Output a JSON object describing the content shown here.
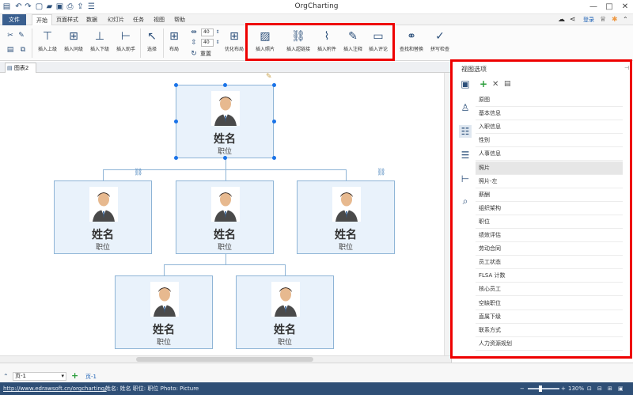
{
  "app": {
    "title": "OrgCharting",
    "login": "登录"
  },
  "menu": {
    "file": "文件",
    "items": [
      "开始",
      "页面样式",
      "数据",
      "幻灯片",
      "任务",
      "视图",
      "帮助"
    ]
  },
  "ribbon": {
    "insert_superior": "插入上级",
    "insert_peer": "插入同级",
    "insert_subordinate": "插入下级",
    "insert_assistant": "插入助手",
    "select": "选择",
    "layout": "布局",
    "spacing_h": "40",
    "spacing_v": "40",
    "reset": "重置",
    "optimize_layout": "优化布局",
    "insert_photo": "插入照片",
    "insert_hyperlink": "插入超链接",
    "insert_attachment": "插入附件",
    "insert_note": "插入注释",
    "insert_comment": "插入评论",
    "find_replace": "查找和替换",
    "spell_check": "拼写检查"
  },
  "tabs": {
    "doc_tab": "图表2"
  },
  "org": {
    "nodes": [
      {
        "name": "姓名",
        "job": "职位"
      },
      {
        "name": "姓名",
        "job": "职位"
      },
      {
        "name": "姓名",
        "job": "职位"
      },
      {
        "name": "姓名",
        "job": "职位"
      },
      {
        "name": "姓名",
        "job": "职位"
      },
      {
        "name": "姓名",
        "job": "职位"
      }
    ]
  },
  "view_panel": {
    "title": "视图选项",
    "items": [
      "原图",
      "基本信息",
      "入职信息",
      "性别",
      "人事信息",
      "照片",
      "照片-左",
      "薪酬",
      "组织架构",
      "职位",
      "绩效评估",
      "劳动合同",
      "员工状态",
      "FLSA 计数",
      "核心员工",
      "空缺职位",
      "直属下级",
      "联系方式",
      "人力资源规划"
    ],
    "selected": "照片"
  },
  "pagebar": {
    "page_select": "页-1",
    "page_tab": "页-1"
  },
  "status": {
    "url": "http://www.edrawsoft.cn/orgcharting/",
    "info": "姓名: 姓名  职位: 职位  Photo: Picture",
    "zoom": "130%"
  },
  "colors": {
    "accent": "#2b4f7a",
    "highlight": "#e00000",
    "card_bg": "#e9f2fb",
    "card_border": "#8eb4d6",
    "statusbar": "#2f4f76"
  }
}
